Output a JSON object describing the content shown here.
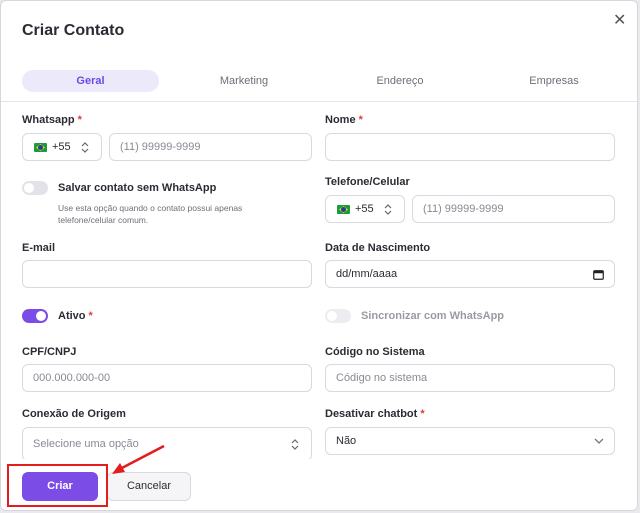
{
  "modal": {
    "title": "Criar Contato",
    "close_icon": "close-icon"
  },
  "tabs": [
    {
      "label": "Geral",
      "active": true
    },
    {
      "label": "Marketing",
      "active": false
    },
    {
      "label": "Endereço",
      "active": false
    },
    {
      "label": "Empresas",
      "active": false
    }
  ],
  "form": {
    "whatsapp": {
      "label": "Whatsapp",
      "required": "*",
      "country_code": "+55",
      "placeholder": "(11) 99999-9999"
    },
    "nome": {
      "label": "Nome",
      "required": "*",
      "value": ""
    },
    "salvar_sem_whatsapp": {
      "label": "Salvar contato sem WhatsApp",
      "checked": false,
      "help_line1": "Use esta opção quando o contato possui apenas",
      "help_line2": "telefone/celular comum."
    },
    "telefone": {
      "label": "Telefone/Celular",
      "country_code": "+55",
      "placeholder": "(11) 99999-9999"
    },
    "email": {
      "label": "E-mail",
      "value": ""
    },
    "nascimento": {
      "label": "Data de Nascimento",
      "value": "dd/mm/aaaa"
    },
    "ativo": {
      "label": "Ativo",
      "required": "*",
      "checked": true
    },
    "sincronizar": {
      "label": "Sincronizar com WhatsApp",
      "checked": false,
      "disabled": true
    },
    "cpf": {
      "label": "CPF/CNPJ",
      "placeholder": "000.000.000-00"
    },
    "codigo": {
      "label": "Código no Sistema",
      "placeholder": "Código no sistema"
    },
    "conexao": {
      "label": "Conexão de Origem",
      "placeholder": "Selecione uma opção"
    },
    "chatbot": {
      "label": "Desativar chatbot",
      "required": "*",
      "value": "Não"
    }
  },
  "footer": {
    "create_label": "Criar",
    "cancel_label": "Cancelar"
  },
  "colors": {
    "accent": "#7c4ce6",
    "required": "#e23b3b",
    "annotation": "#e21d1d"
  }
}
